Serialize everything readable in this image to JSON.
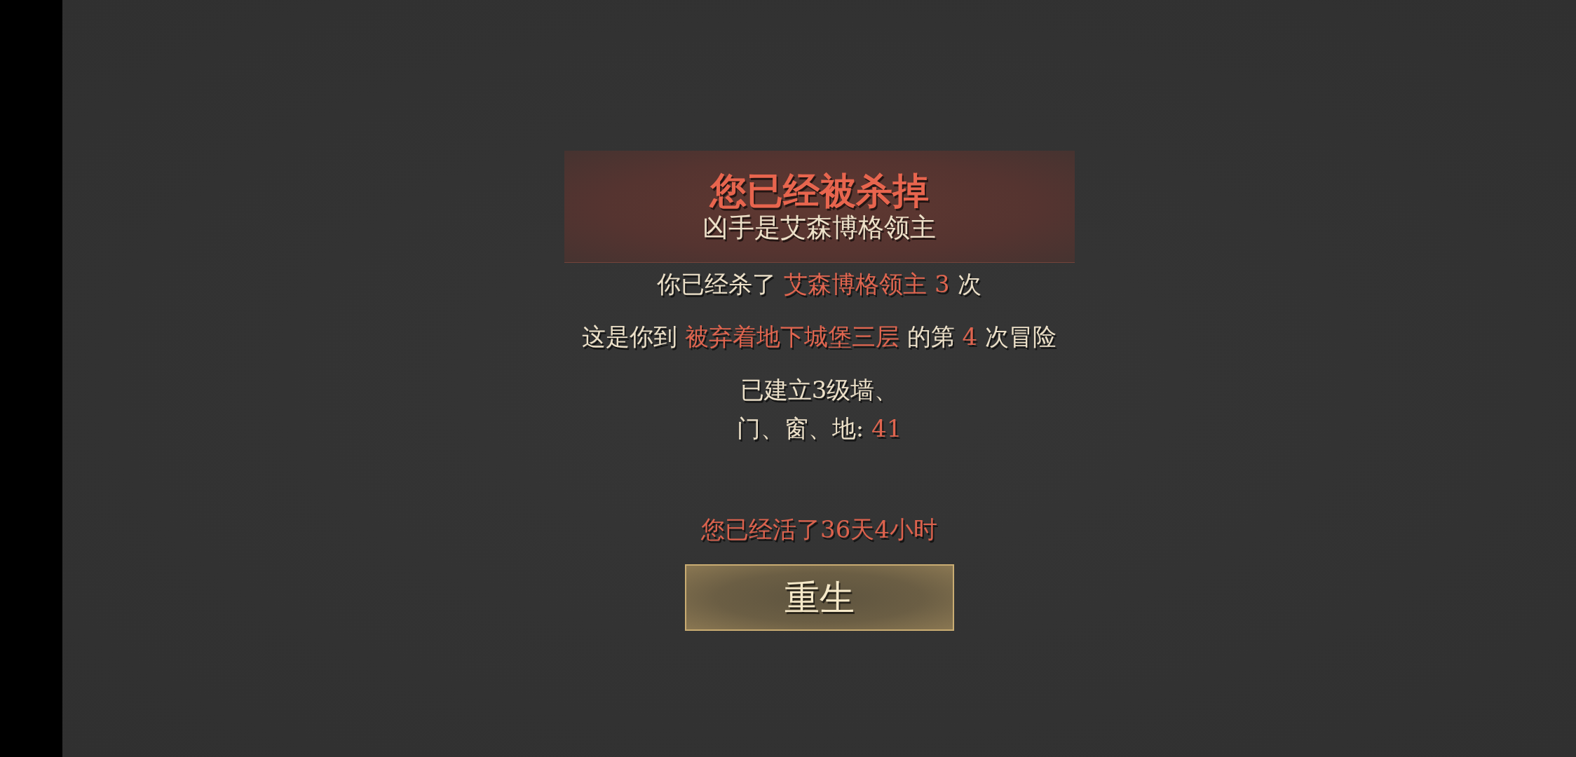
{
  "death_banner": {
    "title": "您已经被杀掉",
    "subtitle": "凶手是艾森博格领主"
  },
  "stats": [
    {
      "lines": [
        [
          {
            "kind": "plain",
            "text": "你已经杀了"
          },
          {
            "kind": "accent",
            "text": "艾森博格领主"
          },
          {
            "kind": "accent",
            "text": "3"
          },
          {
            "kind": "plain",
            "text": "次"
          }
        ]
      ]
    },
    {
      "lines": [
        [
          {
            "kind": "plain",
            "text": "这是你到"
          },
          {
            "kind": "accent",
            "text": "被弃着地下城堡三层"
          },
          {
            "kind": "plain",
            "text": "的第"
          },
          {
            "kind": "accent",
            "text": "4"
          },
          {
            "kind": "plain",
            "text": "次冒险"
          }
        ]
      ]
    },
    {
      "lines": [
        [
          {
            "kind": "plain",
            "text": "已建立3级墙、"
          }
        ],
        [
          {
            "kind": "plain",
            "text": "门、窗、地:"
          },
          {
            "kind": "accent",
            "text": "41"
          }
        ]
      ]
    }
  ],
  "survival": "您已经活了36天4小时",
  "respawn_button": {
    "label": "重生"
  }
}
